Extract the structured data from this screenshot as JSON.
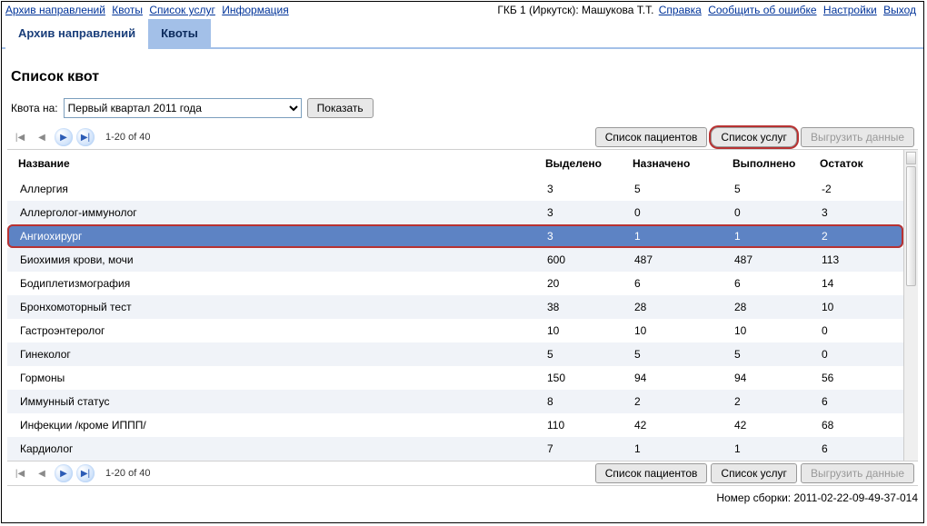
{
  "top_nav_left": [
    "Архив направлений",
    "Квоты",
    "Список услуг",
    "Информация"
  ],
  "top_nav_center": "ГКБ 1 (Иркутск): Машукова Т.Т.",
  "top_nav_right": [
    "Справка",
    "Сообщить об ошибке",
    "Настройки",
    "Выход"
  ],
  "tabs": {
    "archive": "Архив направлений",
    "quotas": "Квоты"
  },
  "page_title": "Список квот",
  "filter": {
    "label": "Квота на:",
    "value": "Первый квартал 2011 года",
    "show_btn": "Показать"
  },
  "pager_text": "1-20 of 40",
  "action_buttons": {
    "patients": "Список пациентов",
    "services": "Список услуг",
    "export": "Выгрузить данные"
  },
  "columns": {
    "name": "Название",
    "allocated": "Выделено",
    "assigned": "Назначено",
    "done": "Выполнено",
    "remain": "Остаток"
  },
  "rows": [
    {
      "name": "Аллергия",
      "allocated": "3",
      "assigned": "5",
      "done": "5",
      "remain": "-2",
      "selected": false
    },
    {
      "name": "Аллерголог-иммунолог",
      "allocated": "3",
      "assigned": "0",
      "done": "0",
      "remain": "3",
      "selected": false
    },
    {
      "name": "Ангиохирург",
      "allocated": "3",
      "assigned": "1",
      "done": "1",
      "remain": "2",
      "selected": true
    },
    {
      "name": "Биохимия крови, мочи",
      "allocated": "600",
      "assigned": "487",
      "done": "487",
      "remain": "113",
      "selected": false
    },
    {
      "name": "Бодиплетизмография",
      "allocated": "20",
      "assigned": "6",
      "done": "6",
      "remain": "14",
      "selected": false
    },
    {
      "name": "Бронхомоторный тест",
      "allocated": "38",
      "assigned": "28",
      "done": "28",
      "remain": "10",
      "selected": false
    },
    {
      "name": "Гастроэнтеролог",
      "allocated": "10",
      "assigned": "10",
      "done": "10",
      "remain": "0",
      "selected": false
    },
    {
      "name": "Гинеколог",
      "allocated": "5",
      "assigned": "5",
      "done": "5",
      "remain": "0",
      "selected": false
    },
    {
      "name": "Гормоны",
      "allocated": "150",
      "assigned": "94",
      "done": "94",
      "remain": "56",
      "selected": false
    },
    {
      "name": "Иммунный статус",
      "allocated": "8",
      "assigned": "2",
      "done": "2",
      "remain": "6",
      "selected": false
    },
    {
      "name": "Инфекции /кроме ИППП/",
      "allocated": "110",
      "assigned": "42",
      "done": "42",
      "remain": "68",
      "selected": false
    },
    {
      "name": "Кардиолог",
      "allocated": "7",
      "assigned": "1",
      "done": "1",
      "remain": "6",
      "selected": false
    }
  ],
  "build_label": "Номер сборки:",
  "build_number": "2011-02-22-09-49-37-014"
}
